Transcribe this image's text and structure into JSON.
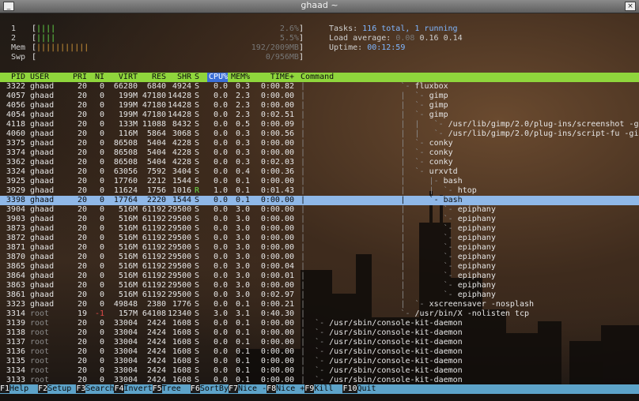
{
  "window": {
    "title": "ghaad ~"
  },
  "meters": {
    "cpu1": {
      "label": "1",
      "bar": "||||",
      "value": "2.6%"
    },
    "cpu2": {
      "label": "2",
      "bar": "||||",
      "value": "5.5%"
    },
    "mem": {
      "label": "Mem",
      "bar": "|||||||||||",
      "value": "192/2009MB"
    },
    "swp": {
      "label": "Swp",
      "bar": "",
      "value": "0/956MB"
    }
  },
  "summary": {
    "tasks_label": "Tasks:",
    "tasks_value": "116 total, 1 running",
    "load_label": "Load average:",
    "load_1": "0.08",
    "load_5": "0.16",
    "load_15": "0.14",
    "uptime_label": "Uptime:",
    "uptime_value": "00:12:59"
  },
  "columns": [
    "PID",
    "USER",
    "PRI",
    "NI",
    "VIRT",
    "RES",
    "SHR",
    "S",
    "CPU%",
    "MEM%",
    "TIME+",
    "Command"
  ],
  "selected_index": 18,
  "processes": [
    {
      "pid": "3322",
      "user": "ghaad",
      "pri": "20",
      "ni": "0",
      "virt": "66280",
      "res": "6840",
      "shr": "4924",
      "s": "S",
      "cpu": "0.0",
      "mem": "0.3",
      "time": "0:00.82",
      "tree": "|                    `- ",
      "cmd": "fluxbox"
    },
    {
      "pid": "4057",
      "user": "ghaad",
      "pri": "20",
      "ni": "0",
      "virt": "199M",
      "res": "47180",
      "shr": "14428",
      "s": "S",
      "cpu": "0.0",
      "mem": "2.3",
      "time": "0:00.00",
      "tree": "|                    |  `- ",
      "cmd": "gimp"
    },
    {
      "pid": "4056",
      "user": "ghaad",
      "pri": "20",
      "ni": "0",
      "virt": "199M",
      "res": "47180",
      "shr": "14428",
      "s": "S",
      "cpu": "0.0",
      "mem": "2.3",
      "time": "0:00.00",
      "tree": "|                    |  `- ",
      "cmd": "gimp"
    },
    {
      "pid": "4054",
      "user": "ghaad",
      "pri": "20",
      "ni": "0",
      "virt": "199M",
      "res": "47180",
      "shr": "14428",
      "s": "S",
      "cpu": "0.0",
      "mem": "2.3",
      "time": "0:02.51",
      "tree": "|                    |  `- ",
      "cmd": "gimp"
    },
    {
      "pid": "4118",
      "user": "ghaad",
      "pri": "20",
      "ni": "0",
      "virt": "133M",
      "res": "11088",
      "shr": "8432",
      "s": "S",
      "cpu": "0.0",
      "mem": "0.5",
      "time": "0:00.09",
      "tree": "|                    |  |   `- ",
      "cmd": "/usr/lib/gimp/2.0/plug-ins/screenshot -g"
    },
    {
      "pid": "4060",
      "user": "ghaad",
      "pri": "20",
      "ni": "0",
      "virt": "116M",
      "res": "5864",
      "shr": "3068",
      "s": "S",
      "cpu": "0.0",
      "mem": "0.3",
      "time": "0:00.56",
      "tree": "|                    |  |   `- ",
      "cmd": "/usr/lib/gimp/2.0/plug-ins/script-fu -gi"
    },
    {
      "pid": "3375",
      "user": "ghaad",
      "pri": "20",
      "ni": "0",
      "virt": "86508",
      "res": "5404",
      "shr": "4228",
      "s": "S",
      "cpu": "0.0",
      "mem": "0.3",
      "time": "0:00.00",
      "tree": "|                    |  `- ",
      "cmd": "conky"
    },
    {
      "pid": "3374",
      "user": "ghaad",
      "pri": "20",
      "ni": "0",
      "virt": "86508",
      "res": "5404",
      "shr": "4228",
      "s": "S",
      "cpu": "0.0",
      "mem": "0.3",
      "time": "0:00.00",
      "tree": "|                    |  `- ",
      "cmd": "conky"
    },
    {
      "pid": "3362",
      "user": "ghaad",
      "pri": "20",
      "ni": "0",
      "virt": "86508",
      "res": "5404",
      "shr": "4228",
      "s": "S",
      "cpu": "0.0",
      "mem": "0.3",
      "time": "0:02.03",
      "tree": "|                    |  `- ",
      "cmd": "conky"
    },
    {
      "pid": "3324",
      "user": "ghaad",
      "pri": "20",
      "ni": "0",
      "virt": "63056",
      "res": "7592",
      "shr": "3404",
      "s": "S",
      "cpu": "0.0",
      "mem": "0.4",
      "time": "0:00.36",
      "tree": "|                    |  `- ",
      "cmd": "urxvtd"
    },
    {
      "pid": "3925",
      "user": "ghaad",
      "pri": "20",
      "ni": "0",
      "virt": "17760",
      "res": "2212",
      "shr": "1544",
      "s": "S",
      "cpu": "0.0",
      "mem": "0.1",
      "time": "0:00.00",
      "tree": "|                    |     |- ",
      "cmd": "bash"
    },
    {
      "pid": "3929",
      "user": "ghaad",
      "pri": "20",
      "ni": "0",
      "virt": "11624",
      "res": "1756",
      "shr": "1016",
      "s": "R",
      "cpu": "1.0",
      "mem": "0.1",
      "time": "0:01.43",
      "tree": "|                    |     |  `- ",
      "cmd": "htop"
    },
    {
      "pid": "3398",
      "user": "ghaad",
      "pri": "20",
      "ni": "0",
      "virt": "17764",
      "res": "2220",
      "shr": "1544",
      "s": "S",
      "cpu": "0.0",
      "mem": "0.1",
      "time": "0:00.00",
      "tree": "|                    |     `- ",
      "cmd": "bash"
    },
    {
      "pid": "3904",
      "user": "ghaad",
      "pri": "20",
      "ni": "0",
      "virt": "516M",
      "res": "61192",
      "shr": "29500",
      "s": "S",
      "cpu": "0.0",
      "mem": "3.0",
      "time": "0:00.00",
      "tree": "|                    |        `- ",
      "cmd": "epiphany"
    },
    {
      "pid": "3903",
      "user": "ghaad",
      "pri": "20",
      "ni": "0",
      "virt": "516M",
      "res": "61192",
      "shr": "29500",
      "s": "S",
      "cpu": "0.0",
      "mem": "3.0",
      "time": "0:00.00",
      "tree": "|                    |        `- ",
      "cmd": "epiphany"
    },
    {
      "pid": "3873",
      "user": "ghaad",
      "pri": "20",
      "ni": "0",
      "virt": "516M",
      "res": "61192",
      "shr": "29500",
      "s": "S",
      "cpu": "0.0",
      "mem": "3.0",
      "time": "0:00.00",
      "tree": "|                    |        `- ",
      "cmd": "epiphany"
    },
    {
      "pid": "3872",
      "user": "ghaad",
      "pri": "20",
      "ni": "0",
      "virt": "516M",
      "res": "61192",
      "shr": "29500",
      "s": "S",
      "cpu": "0.0",
      "mem": "3.0",
      "time": "0:00.00",
      "tree": "|                    |        `- ",
      "cmd": "epiphany"
    },
    {
      "pid": "3871",
      "user": "ghaad",
      "pri": "20",
      "ni": "0",
      "virt": "516M",
      "res": "61192",
      "shr": "29500",
      "s": "S",
      "cpu": "0.0",
      "mem": "3.0",
      "time": "0:00.00",
      "tree": "|                    |        `- ",
      "cmd": "epiphany"
    },
    {
      "pid": "3870",
      "user": "ghaad",
      "pri": "20",
      "ni": "0",
      "virt": "516M",
      "res": "61192",
      "shr": "29500",
      "s": "S",
      "cpu": "0.0",
      "mem": "3.0",
      "time": "0:00.00",
      "tree": "|                    |        `- ",
      "cmd": "epiphany"
    },
    {
      "pid": "3865",
      "user": "ghaad",
      "pri": "20",
      "ni": "0",
      "virt": "516M",
      "res": "61192",
      "shr": "29500",
      "s": "S",
      "cpu": "0.0",
      "mem": "3.0",
      "time": "0:00.04",
      "tree": "|                    |        `- ",
      "cmd": "epiphany"
    },
    {
      "pid": "3864",
      "user": "ghaad",
      "pri": "20",
      "ni": "0",
      "virt": "516M",
      "res": "61192",
      "shr": "29500",
      "s": "S",
      "cpu": "0.0",
      "mem": "3.0",
      "time": "0:00.01",
      "tree": "|                    |        `- ",
      "cmd": "epiphany"
    },
    {
      "pid": "3863",
      "user": "ghaad",
      "pri": "20",
      "ni": "0",
      "virt": "516M",
      "res": "61192",
      "shr": "29500",
      "s": "S",
      "cpu": "0.0",
      "mem": "3.0",
      "time": "0:00.00",
      "tree": "|                    |        `- ",
      "cmd": "epiphany"
    },
    {
      "pid": "3861",
      "user": "ghaad",
      "pri": "20",
      "ni": "0",
      "virt": "516M",
      "res": "61192",
      "shr": "29500",
      "s": "S",
      "cpu": "0.0",
      "mem": "3.0",
      "time": "0:02.97",
      "tree": "|                    |        `- ",
      "cmd": "epiphany"
    },
    {
      "pid": "3323",
      "user": "ghaad",
      "pri": "20",
      "ni": "0",
      "virt": "49848",
      "res": "2380",
      "shr": "1776",
      "s": "S",
      "cpu": "0.0",
      "mem": "0.1",
      "time": "0:00.21",
      "tree": "|                    |  `- ",
      "cmd": "xscreensaver -nosplash"
    },
    {
      "pid": "3314",
      "user": "root",
      "pri": "19",
      "ni": "-1",
      "virt": "157M",
      "res": "64108",
      "shr": "12340",
      "s": "S",
      "cpu": "3.0",
      "mem": "3.1",
      "time": "0:40.30",
      "tree": "|                    `- ",
      "cmd": "/usr/bin/X -nolisten tcp"
    },
    {
      "pid": "3139",
      "user": "root",
      "pri": "20",
      "ni": "0",
      "virt": "33004",
      "res": "2424",
      "shr": "1608",
      "s": "S",
      "cpu": "0.0",
      "mem": "0.1",
      "time": "0:00.00",
      "tree": "|  `- ",
      "cmd": "/usr/sbin/console-kit-daemon"
    },
    {
      "pid": "3138",
      "user": "root",
      "pri": "20",
      "ni": "0",
      "virt": "33004",
      "res": "2424",
      "shr": "1608",
      "s": "S",
      "cpu": "0.0",
      "mem": "0.1",
      "time": "0:00.00",
      "tree": "|  `- ",
      "cmd": "/usr/sbin/console-kit-daemon"
    },
    {
      "pid": "3137",
      "user": "root",
      "pri": "20",
      "ni": "0",
      "virt": "33004",
      "res": "2424",
      "shr": "1608",
      "s": "S",
      "cpu": "0.0",
      "mem": "0.1",
      "time": "0:00.00",
      "tree": "|  `- ",
      "cmd": "/usr/sbin/console-kit-daemon"
    },
    {
      "pid": "3136",
      "user": "root",
      "pri": "20",
      "ni": "0",
      "virt": "33004",
      "res": "2424",
      "shr": "1608",
      "s": "S",
      "cpu": "0.0",
      "mem": "0.1",
      "time": "0:00.00",
      "tree": "|  `- ",
      "cmd": "/usr/sbin/console-kit-daemon"
    },
    {
      "pid": "3135",
      "user": "root",
      "pri": "20",
      "ni": "0",
      "virt": "33004",
      "res": "2424",
      "shr": "1608",
      "s": "S",
      "cpu": "0.0",
      "mem": "0.1",
      "time": "0:00.00",
      "tree": "|  `- ",
      "cmd": "/usr/sbin/console-kit-daemon"
    },
    {
      "pid": "3134",
      "user": "root",
      "pri": "20",
      "ni": "0",
      "virt": "33004",
      "res": "2424",
      "shr": "1608",
      "s": "S",
      "cpu": "0.0",
      "mem": "0.1",
      "time": "0:00.00",
      "tree": "|  `- ",
      "cmd": "/usr/sbin/console-kit-daemon"
    },
    {
      "pid": "3133",
      "user": "root",
      "pri": "20",
      "ni": "0",
      "virt": "33004",
      "res": "2424",
      "shr": "1608",
      "s": "S",
      "cpu": "0.0",
      "mem": "0.1",
      "time": "0:00.00",
      "tree": "|  `- ",
      "cmd": "/usr/sbin/console-kit-daemon"
    }
  ],
  "function_keys": [
    {
      "key": "F1",
      "label": "Help"
    },
    {
      "key": "F2",
      "label": "Setup"
    },
    {
      "key": "F3",
      "label": "Search"
    },
    {
      "key": "F4",
      "label": "Invert"
    },
    {
      "key": "F5",
      "label": "Tree"
    },
    {
      "key": "F6",
      "label": "SortBy"
    },
    {
      "key": "F7",
      "label": "Nice -"
    },
    {
      "key": "F8",
      "label": "Nice +"
    },
    {
      "key": "F9",
      "label": "Kill"
    },
    {
      "key": "F10",
      "label": "Quit"
    }
  ],
  "colors": {
    "header_bg": "#8fd63c",
    "selected_bg": "#8fb8e8",
    "fbar_bg": "#5da3c9",
    "accent_cyan": "#7fb6ff"
  }
}
